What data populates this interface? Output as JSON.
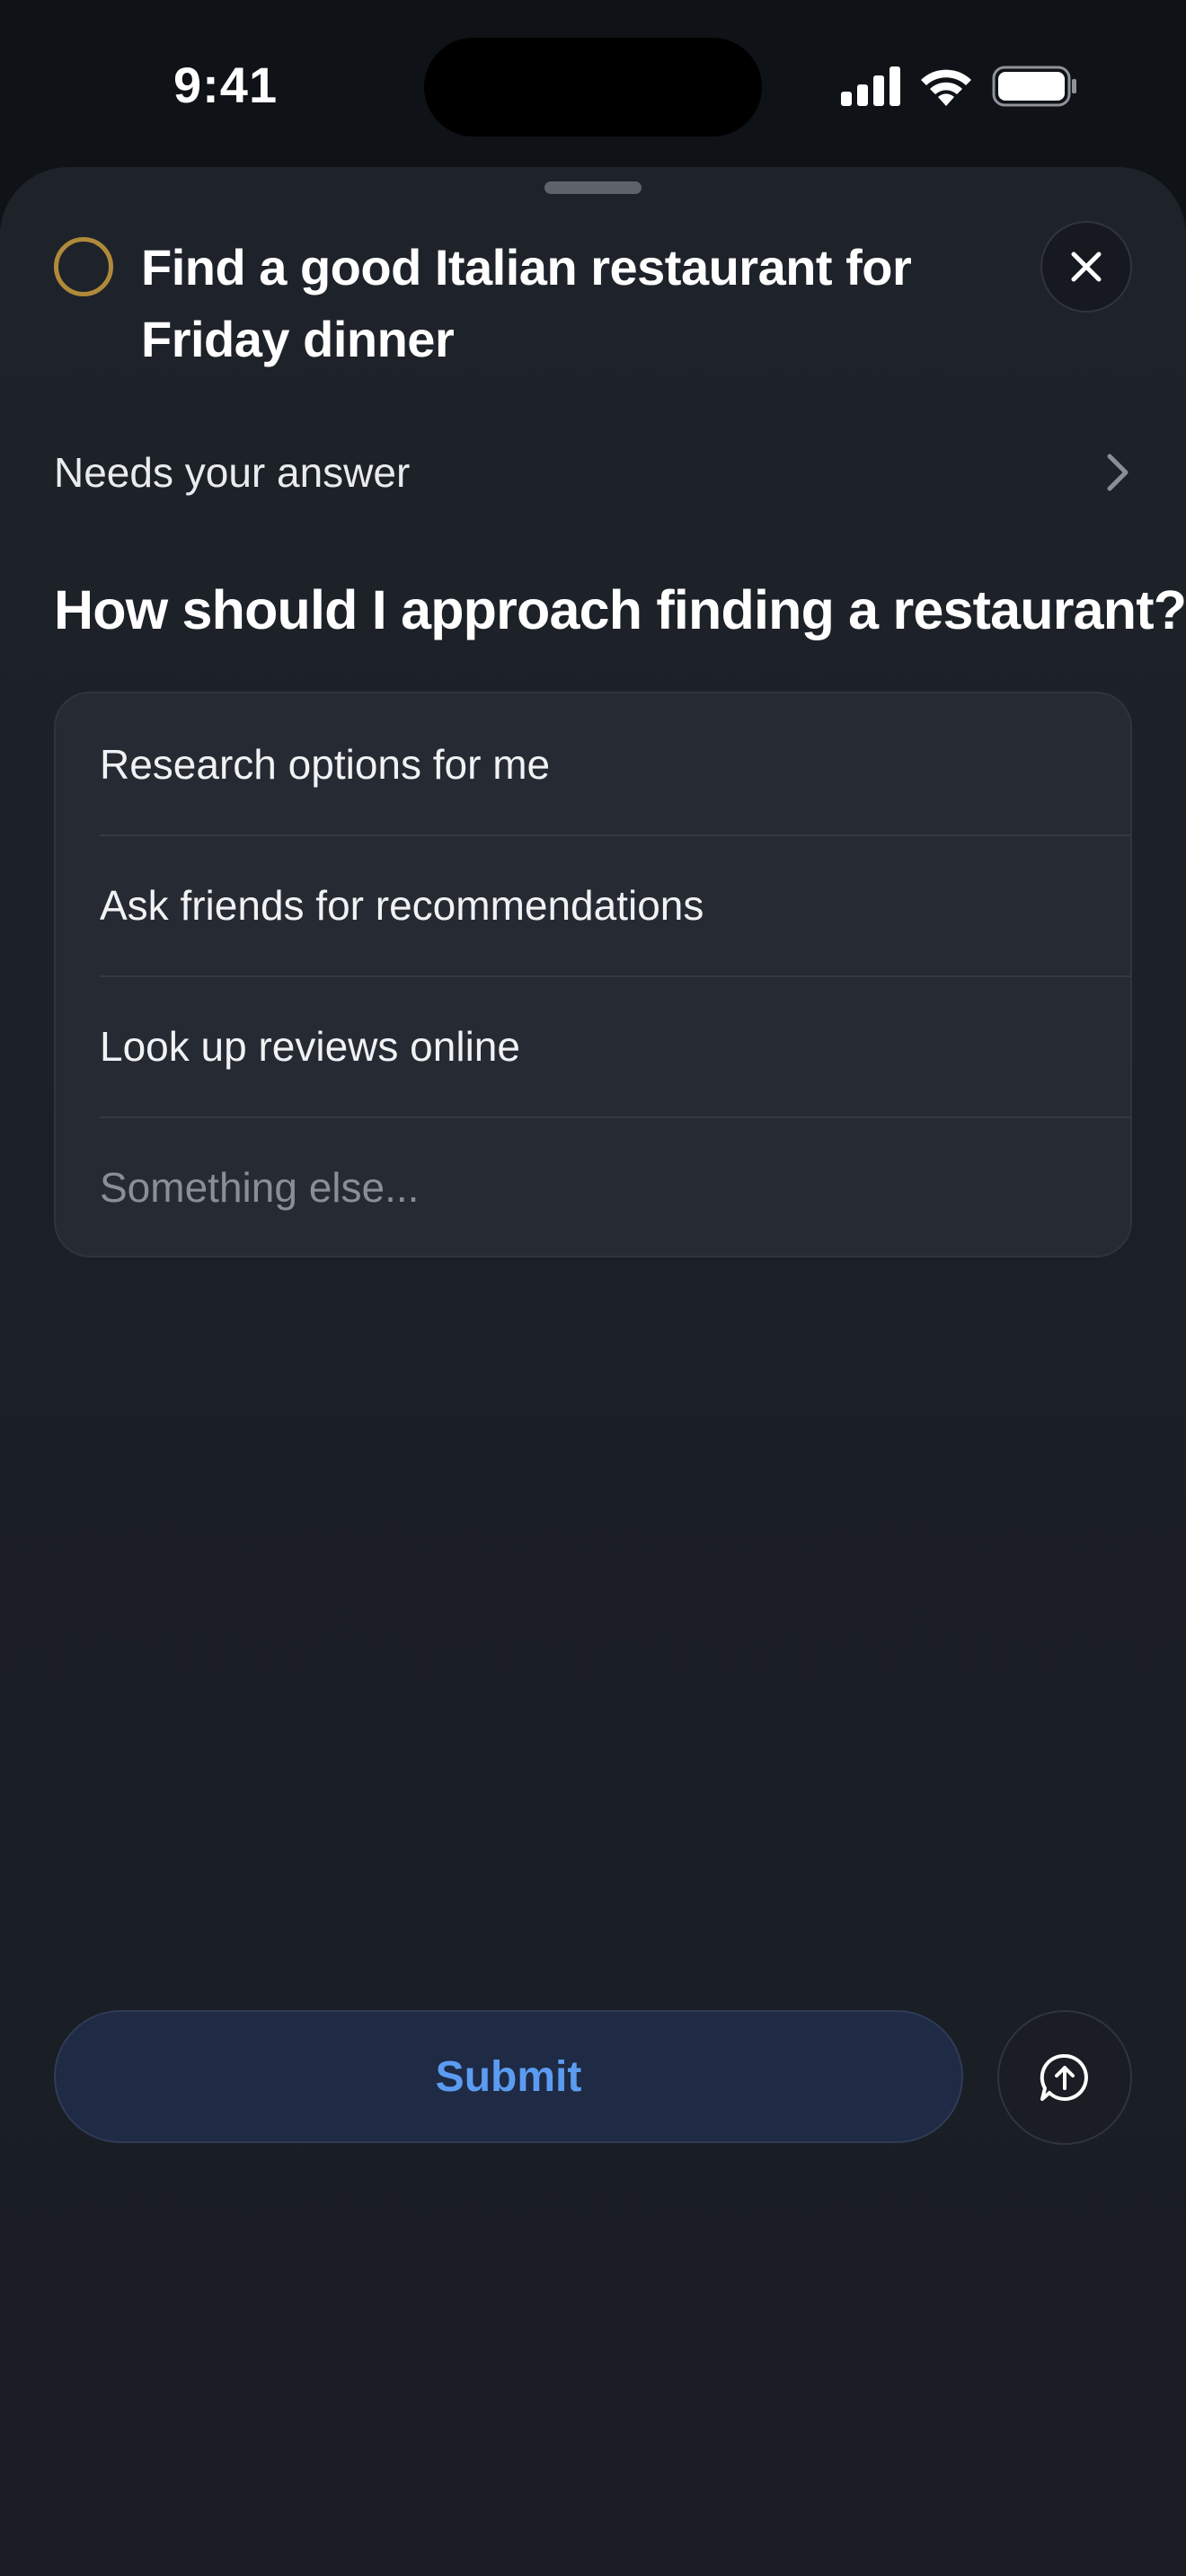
{
  "status_bar": {
    "time": "9:41",
    "icons": [
      "signal-icon",
      "wifi-icon",
      "battery-icon"
    ]
  },
  "task": {
    "title": "Find a good Italian restaurant for Friday dinner",
    "status_icon": "circle-outline-icon",
    "status_color": "#b08a3a"
  },
  "needs": {
    "label": "Needs your answer"
  },
  "question": {
    "text": "How should I approach finding a restaurant?",
    "options": [
      "Research options for me",
      "Ask friends for recommendations",
      "Look up reviews online"
    ],
    "other_placeholder": "Something else..."
  },
  "actions": {
    "submit_label": "Submit",
    "submit_color": "#5b9cf2",
    "chat_icon": "chat-bubble-arrow-up-icon"
  }
}
